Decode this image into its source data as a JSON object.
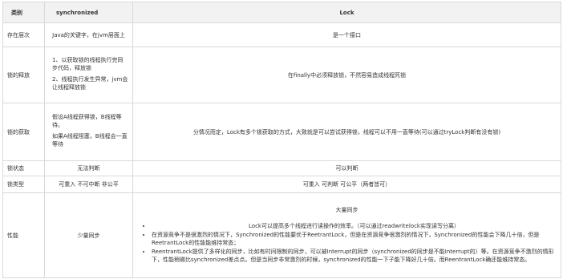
{
  "headers": [
    "类别",
    "synchronized",
    "Lock"
  ],
  "rows": [
    {
      "category": "存在层次",
      "sync": "Java的关键字，在jvm层面上",
      "lock": "是一个接口"
    },
    {
      "category": "锁的释放",
      "sync_items": [
        "1、以获取锁的线程执行完同步代码，释放锁",
        "2、线程执行发生异常，jvm会让线程释放锁"
      ],
      "lock": "在finally中必须释放锁，不然容易造成线程死锁"
    },
    {
      "category": "锁的获取",
      "sync_items": [
        "假设A线程获得锁，B线程等待。",
        "如果A线程阻塞，B线程会一直等待"
      ],
      "lock": "分情况而定，Lock有多个锁获取的方式，大致就是可以尝试获得锁，线程可以不用一直等待(可以通过tryLock判断有没有锁)"
    },
    {
      "category": "锁状态",
      "sync": "无法判断",
      "lock": "可以判断"
    },
    {
      "category": "锁类型",
      "sync": "可重入 不可中断 非公平",
      "lock": "可重入 可判断 可公平（两者皆可）"
    },
    {
      "category": "性能",
      "sync": "少量同步",
      "lock_title": "大量同步",
      "lock_items": [
        "Lock可以提高多个线程进行读操作的效率。（可以通过readwritelock实现读写分离）",
        "在资源竞争不是很激烈的情况下，Synchronized的性能要优于ReetrantLock，但是在资源竞争很激烈的情况下，Synchronized的性能会下降几十倍，但是ReetrantLock的性能能维持常态；",
        "ReentrantLock提供了多样化的同步，比如有时间限制的同步，可以被Interrupt的同步（synchronized的同步是不能Interrupt的）等。在资源竞争不激烈的情形下，性能稍微比synchronized差点点。但是当同步非常激烈的时候，synchronized的性能一下子能下降好几十倍。而ReentrantLock确还能维持常态。"
      ]
    }
  ]
}
